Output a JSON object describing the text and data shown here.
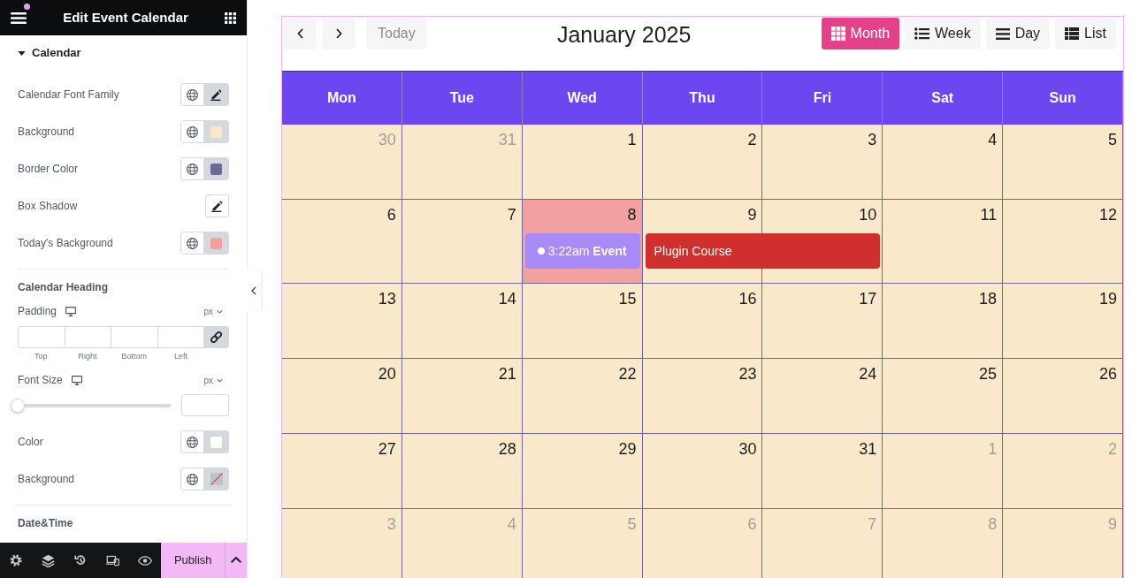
{
  "editor": {
    "title": "Edit Event Calendar",
    "menu_notification": true,
    "section": {
      "title": "Calendar",
      "expanded": true,
      "controls": [
        {
          "kind": "font",
          "label": "Calendar Font Family",
          "edited": true
        },
        {
          "kind": "color",
          "label": "Background",
          "color": "#fae8ca",
          "unset": false
        },
        {
          "kind": "color",
          "label": "Border Color",
          "color": "#6e6a96",
          "unset": false
        },
        {
          "kind": "shadow",
          "label": "Box Shadow",
          "edited": false
        },
        {
          "kind": "color",
          "label": "Today's Background",
          "color": "#f2a0a0",
          "unset": false
        },
        {
          "kind": "heading",
          "label": "Calendar Heading"
        },
        {
          "kind": "dimensions",
          "label": "Padding",
          "unit": "px",
          "fields": [
            "Top",
            "Right",
            "Bottom",
            "Left"
          ],
          "linked": true
        },
        {
          "kind": "slider",
          "label": "Font Size",
          "unit": "px",
          "level": 0
        },
        {
          "kind": "color",
          "label": "Color",
          "color": "#ffffff",
          "unset": false
        },
        {
          "kind": "color",
          "label": "Background",
          "unset": true
        },
        {
          "kind": "heading",
          "label": "Date&Time"
        }
      ]
    },
    "publish_label": "Publish"
  },
  "calendar": {
    "toolbar": {
      "today": {
        "label": "Today",
        "disabled": true
      },
      "title": "January 2025",
      "views": [
        {
          "kind": "month",
          "label": "Month",
          "selected": true
        },
        {
          "kind": "week",
          "label": "Week",
          "selected": false
        },
        {
          "kind": "day",
          "label": "Day",
          "selected": false
        },
        {
          "kind": "list",
          "label": "List",
          "selected": false
        }
      ]
    },
    "weekdays": [
      "Mon",
      "Tue",
      "Wed",
      "Thu",
      "Fri",
      "Sat",
      "Sun"
    ],
    "weeks": [
      {
        "days": [
          {
            "day": "30",
            "other_month": true,
            "today": false
          },
          {
            "day": "31",
            "other_month": true,
            "today": false
          },
          {
            "day": "1",
            "other_month": false,
            "today": false
          },
          {
            "day": "2",
            "other_month": false,
            "today": false
          },
          {
            "day": "3",
            "other_month": false,
            "today": false
          },
          {
            "day": "4",
            "other_month": false,
            "today": false
          },
          {
            "day": "5",
            "other_month": false,
            "today": false
          }
        ]
      },
      {
        "days": [
          {
            "day": "6",
            "other_month": false,
            "today": false
          },
          {
            "day": "7",
            "other_month": false,
            "today": false
          },
          {
            "day": "8",
            "other_month": false,
            "today": true,
            "events": [
              {
                "kind": "timed",
                "time": "3:22am",
                "title": "Event",
                "color": "#a88af8",
                "continues_next_day": false
              }
            ]
          },
          {
            "day": "9",
            "other_month": false,
            "today": false,
            "events": [
              {
                "kind": "all_day",
                "title": "Plugin Course",
                "color": "#d0302d",
                "continues_next_day": true
              }
            ]
          },
          {
            "day": "10",
            "other_month": false,
            "today": false
          },
          {
            "day": "11",
            "other_month": false,
            "today": false
          },
          {
            "day": "12",
            "other_month": false,
            "today": false
          }
        ]
      },
      {
        "days": [
          {
            "day": "13",
            "other_month": false,
            "today": false
          },
          {
            "day": "14",
            "other_month": false,
            "today": false
          },
          {
            "day": "15",
            "other_month": false,
            "today": false
          },
          {
            "day": "16",
            "other_month": false,
            "today": false
          },
          {
            "day": "17",
            "other_month": false,
            "today": false
          },
          {
            "day": "18",
            "other_month": false,
            "today": false
          },
          {
            "day": "19",
            "other_month": false,
            "today": false
          }
        ]
      },
      {
        "days": [
          {
            "day": "20",
            "other_month": false,
            "today": false
          },
          {
            "day": "21",
            "other_month": false,
            "today": false
          },
          {
            "day": "22",
            "other_month": false,
            "today": false
          },
          {
            "day": "23",
            "other_month": false,
            "today": false
          },
          {
            "day": "24",
            "other_month": false,
            "today": false
          },
          {
            "day": "25",
            "other_month": false,
            "today": false
          },
          {
            "day": "26",
            "other_month": false,
            "today": false
          }
        ]
      },
      {
        "days": [
          {
            "day": "27",
            "other_month": false,
            "today": false
          },
          {
            "day": "28",
            "other_month": false,
            "today": false
          },
          {
            "day": "29",
            "other_month": false,
            "today": false
          },
          {
            "day": "30",
            "other_month": false,
            "today": false
          },
          {
            "day": "31",
            "other_month": false,
            "today": false
          },
          {
            "day": "1",
            "other_month": true,
            "today": false
          },
          {
            "day": "2",
            "other_month": true,
            "today": false
          }
        ]
      },
      {
        "days": [
          {
            "day": "3",
            "other_month": true,
            "today": false
          },
          {
            "day": "4",
            "other_month": true,
            "today": false
          },
          {
            "day": "5",
            "other_month": true,
            "today": false
          },
          {
            "day": "6",
            "other_month": true,
            "today": false
          },
          {
            "day": "7",
            "other_month": true,
            "today": false
          },
          {
            "day": "8",
            "other_month": true,
            "today": false
          },
          {
            "day": "9",
            "other_month": true,
            "today": false
          }
        ]
      }
    ]
  }
}
